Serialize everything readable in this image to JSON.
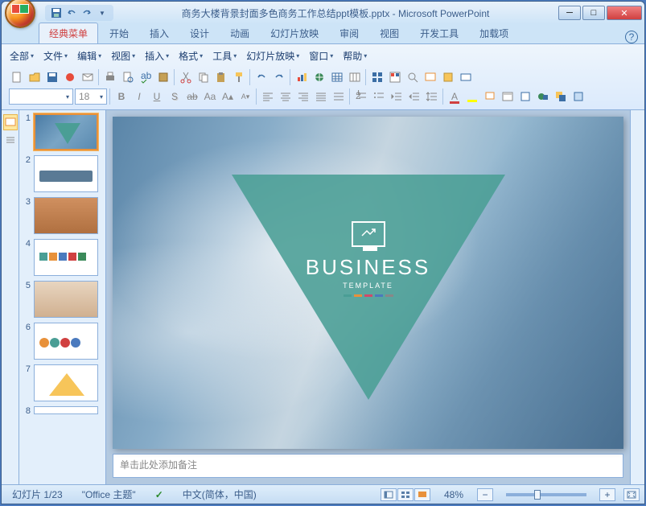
{
  "titlebar": {
    "title": "商务大楼背景封面多色商务工作总结ppt模板.pptx - Microsoft PowerPoint"
  },
  "ribbon": {
    "tabs": [
      "经典菜单",
      "开始",
      "插入",
      "设计",
      "动画",
      "幻灯片放映",
      "审阅",
      "视图",
      "开发工具",
      "加载项"
    ],
    "active_tab": "经典菜单",
    "menus": [
      "全部",
      "文件",
      "编辑",
      "视图",
      "插入",
      "格式",
      "工具",
      "幻灯片放映",
      "窗口",
      "帮助"
    ],
    "font_size": "18"
  },
  "slide": {
    "title": "BUSINESS",
    "subtitle": "TEMPLATE",
    "accent_colors": [
      "#4a9e95",
      "#e8913a",
      "#d04a6a",
      "#4a7abe",
      "#888"
    ]
  },
  "notes": {
    "placeholder": "单击此处添加备注"
  },
  "statusbar": {
    "slide_info": "幻灯片 1/23",
    "theme": "\"Office 主题\"",
    "language": "中文(简体，中国)",
    "zoom": "48%"
  },
  "thumbnails": {
    "count": 8,
    "selected": 1
  }
}
